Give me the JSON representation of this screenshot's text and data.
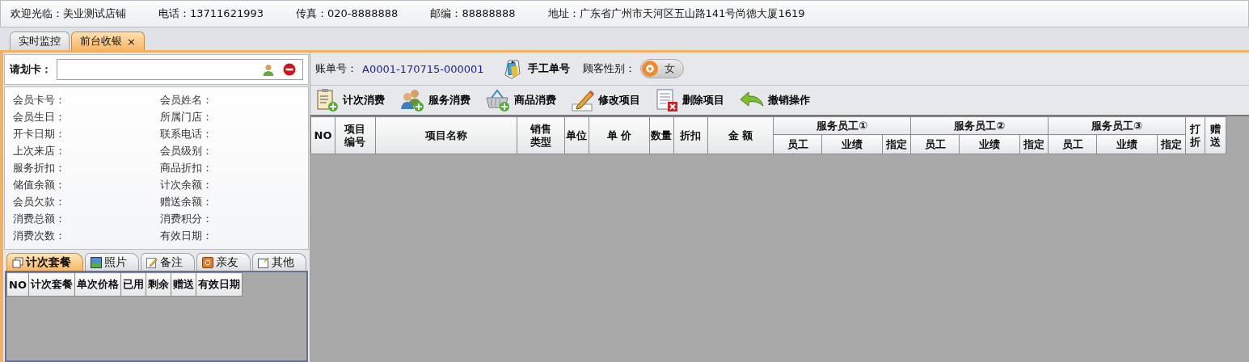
{
  "info_bar": [
    {
      "label": "欢迎光临：",
      "value": "美业测试店铺"
    },
    {
      "label": "电话：",
      "value": "13711621993"
    },
    {
      "label": "传真：",
      "value": "020-8888888"
    },
    {
      "label": "邮编：",
      "value": "88888888"
    },
    {
      "label": "地址：",
      "value": "广东省广州市天河区五山路141号尚德大厦1619"
    }
  ],
  "tabs": [
    {
      "label": "实时监控",
      "selected": false
    },
    {
      "label": "前台收银",
      "selected": true,
      "close": "×"
    }
  ],
  "card": {
    "label": "请划卡："
  },
  "member_fields": [
    {
      "label": "会员卡号："
    },
    {
      "label": "会员姓名："
    },
    {
      "label": "会员生日："
    },
    {
      "label": "所属门店："
    },
    {
      "label": "开卡日期："
    },
    {
      "label": "联系电话："
    },
    {
      "label": "上次来店："
    },
    {
      "label": "会员级别："
    },
    {
      "label": "服务折扣："
    },
    {
      "label": "商品折扣："
    },
    {
      "label": "储值余额："
    },
    {
      "label": "计次余额："
    },
    {
      "label": "会员欠款："
    },
    {
      "label": "赠送余额："
    },
    {
      "label": "消费总额："
    },
    {
      "label": "消费积分："
    },
    {
      "label": "消费次数："
    },
    {
      "label": "有效日期："
    }
  ],
  "side_tabs": [
    {
      "label": "计次套餐",
      "selected": true,
      "kind": "pages"
    },
    {
      "label": "照片",
      "selected": false,
      "kind": "photo"
    },
    {
      "label": "备注",
      "selected": false,
      "kind": "note"
    },
    {
      "label": "亲友",
      "selected": false,
      "kind": "contacts"
    },
    {
      "label": "其他",
      "selected": false,
      "kind": "other"
    }
  ],
  "package_table": {
    "columns": [
      "NO",
      "计次套餐",
      "单次价格",
      "已用",
      "剩余",
      "赠送",
      "有效日期"
    ]
  },
  "bill": {
    "label": "账单号：",
    "number": "A0001-170715-000001",
    "manual_button": "手工单号",
    "gender_label": "顾客性别：",
    "gender": "女"
  },
  "toolbar": [
    {
      "label": "计次消费",
      "kind": "clipboard"
    },
    {
      "label": "服务消费",
      "kind": "people"
    },
    {
      "label": "商品消费",
      "kind": "basket"
    },
    {
      "label": "修改项目",
      "kind": "pencil"
    },
    {
      "label": "删除项目",
      "kind": "delete"
    },
    {
      "label": "撤销操作",
      "kind": "undo"
    }
  ],
  "items_table": {
    "columns": [
      {
        "label": "NO"
      },
      {
        "label": "项目编号"
      },
      {
        "label": "项目名称"
      },
      {
        "label": "销售类型"
      },
      {
        "label": "单位"
      },
      {
        "label": "单 价"
      },
      {
        "label": "数量"
      },
      {
        "label": "折扣"
      },
      {
        "label": "金 额"
      },
      {
        "label": "服务员工①",
        "children": [
          "员工",
          "业绩",
          "指定"
        ]
      },
      {
        "label": "服务员工②",
        "children": [
          "员工",
          "业绩",
          "指定"
        ]
      },
      {
        "label": "服务员工③",
        "children": [
          "员工",
          "业绩",
          "指定"
        ]
      },
      {
        "label": "打折"
      },
      {
        "label": "赠送"
      }
    ]
  }
}
